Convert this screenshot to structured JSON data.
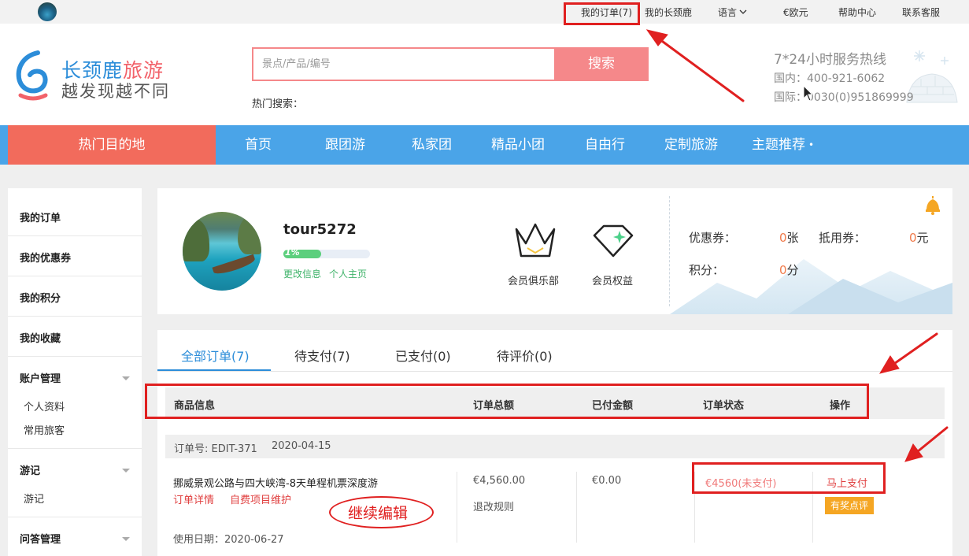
{
  "topbar": {
    "links": [
      "我的订单(7)",
      "我的长颈鹿",
      "语言",
      "€欧元",
      "帮助中心",
      "联系客服"
    ]
  },
  "header": {
    "logo_name_a": "长颈鹿",
    "logo_name_b": "旅游",
    "logo_slogan": "越发现越不同",
    "search_placeholder": "景点/产品/编号",
    "search_button": "搜索",
    "hot_search": "热门搜索：",
    "hotline_title": "7*24小时服务热线",
    "hotline_domestic": "国内：400-921-6062",
    "hotline_international": "国际：0030(0)951869999"
  },
  "nav": {
    "hot": "热门目的地",
    "items": [
      "首页",
      "跟团游",
      "私家团",
      "精品小团",
      "自由行",
      "定制旅游",
      "主题推荐"
    ]
  },
  "sidebar": {
    "my_orders": "我的订单",
    "my_coupons": "我的优惠券",
    "my_points": "我的积分",
    "my_favorites": "我的收藏",
    "account": "账户管理",
    "account_items": [
      "个人资料",
      "常用旅客"
    ],
    "travel_notes": "游记",
    "travel_notes_items": [
      "游记"
    ],
    "qa": "问答管理"
  },
  "profile": {
    "username": "tour5272",
    "level_badge": "1%",
    "level_progress": 0.44,
    "edit_info": "更改信息",
    "home_page": "个人主页",
    "club_label": "会员俱乐部",
    "rights_label": "会员权益",
    "coupon_label": "优惠券：",
    "coupon_value": "0",
    "coupon_unit": "张",
    "voucher_label": "抵用券：",
    "voucher_value": "0",
    "voucher_unit": "元",
    "points_label": "积分：",
    "points_value": "0",
    "points_unit": "分"
  },
  "orders": {
    "tabs": [
      "全部订单(7)",
      "待支付(7)",
      "已支付(0)",
      "待评价(0)"
    ],
    "columns": [
      "商品信息",
      "订单总额",
      "已付金额",
      "订单状态",
      "操作"
    ],
    "order_no": "订单号: EDIT-371",
    "order_date": "2020-04-15",
    "product": "挪威景观公路与四大峡湾-8天单程机票深度游",
    "detail_link": "订单详情",
    "self_pay_link": "自费项目维护",
    "use_date": "使用日期：2020-06-27",
    "total": "€4,560.00",
    "refund_rule": "退改规则",
    "paid": "€0.00",
    "status": "€4560(未支付)",
    "pay_now": "马上支付",
    "review": "有奖点评"
  },
  "annotations": {
    "continue_edit": "继续编辑"
  },
  "colors": {
    "brand_blue": "#4aa4e8",
    "hot_red": "#f26b5c",
    "search_pink": "#f5888a",
    "annotation_red": "#e02020",
    "review_orange": "#f5a623"
  }
}
